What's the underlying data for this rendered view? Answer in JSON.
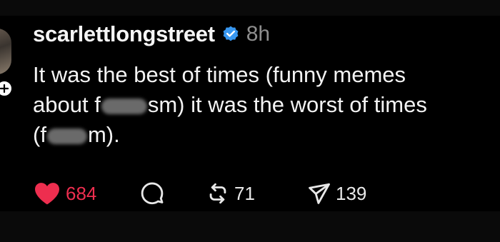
{
  "post": {
    "username": "scarlettlongstreet",
    "timestamp": "8h",
    "text": {
      "line1": "It was the best of times (funny memes",
      "line2_a": "about f",
      "line2_b": "sm) it was the worst of times",
      "line3_a": "(f",
      "line3_b": "m)."
    }
  },
  "actions": {
    "likes": "684",
    "reposts": "71",
    "shares": "139"
  },
  "colors": {
    "like_red": "#ee2e4f",
    "verified_blue": "#3897f0",
    "muted": "#8e8e8e"
  },
  "icons": [
    "heart-icon",
    "reply-icon",
    "repost-icon",
    "share-icon",
    "verified-badge-icon",
    "plus-icon"
  ]
}
